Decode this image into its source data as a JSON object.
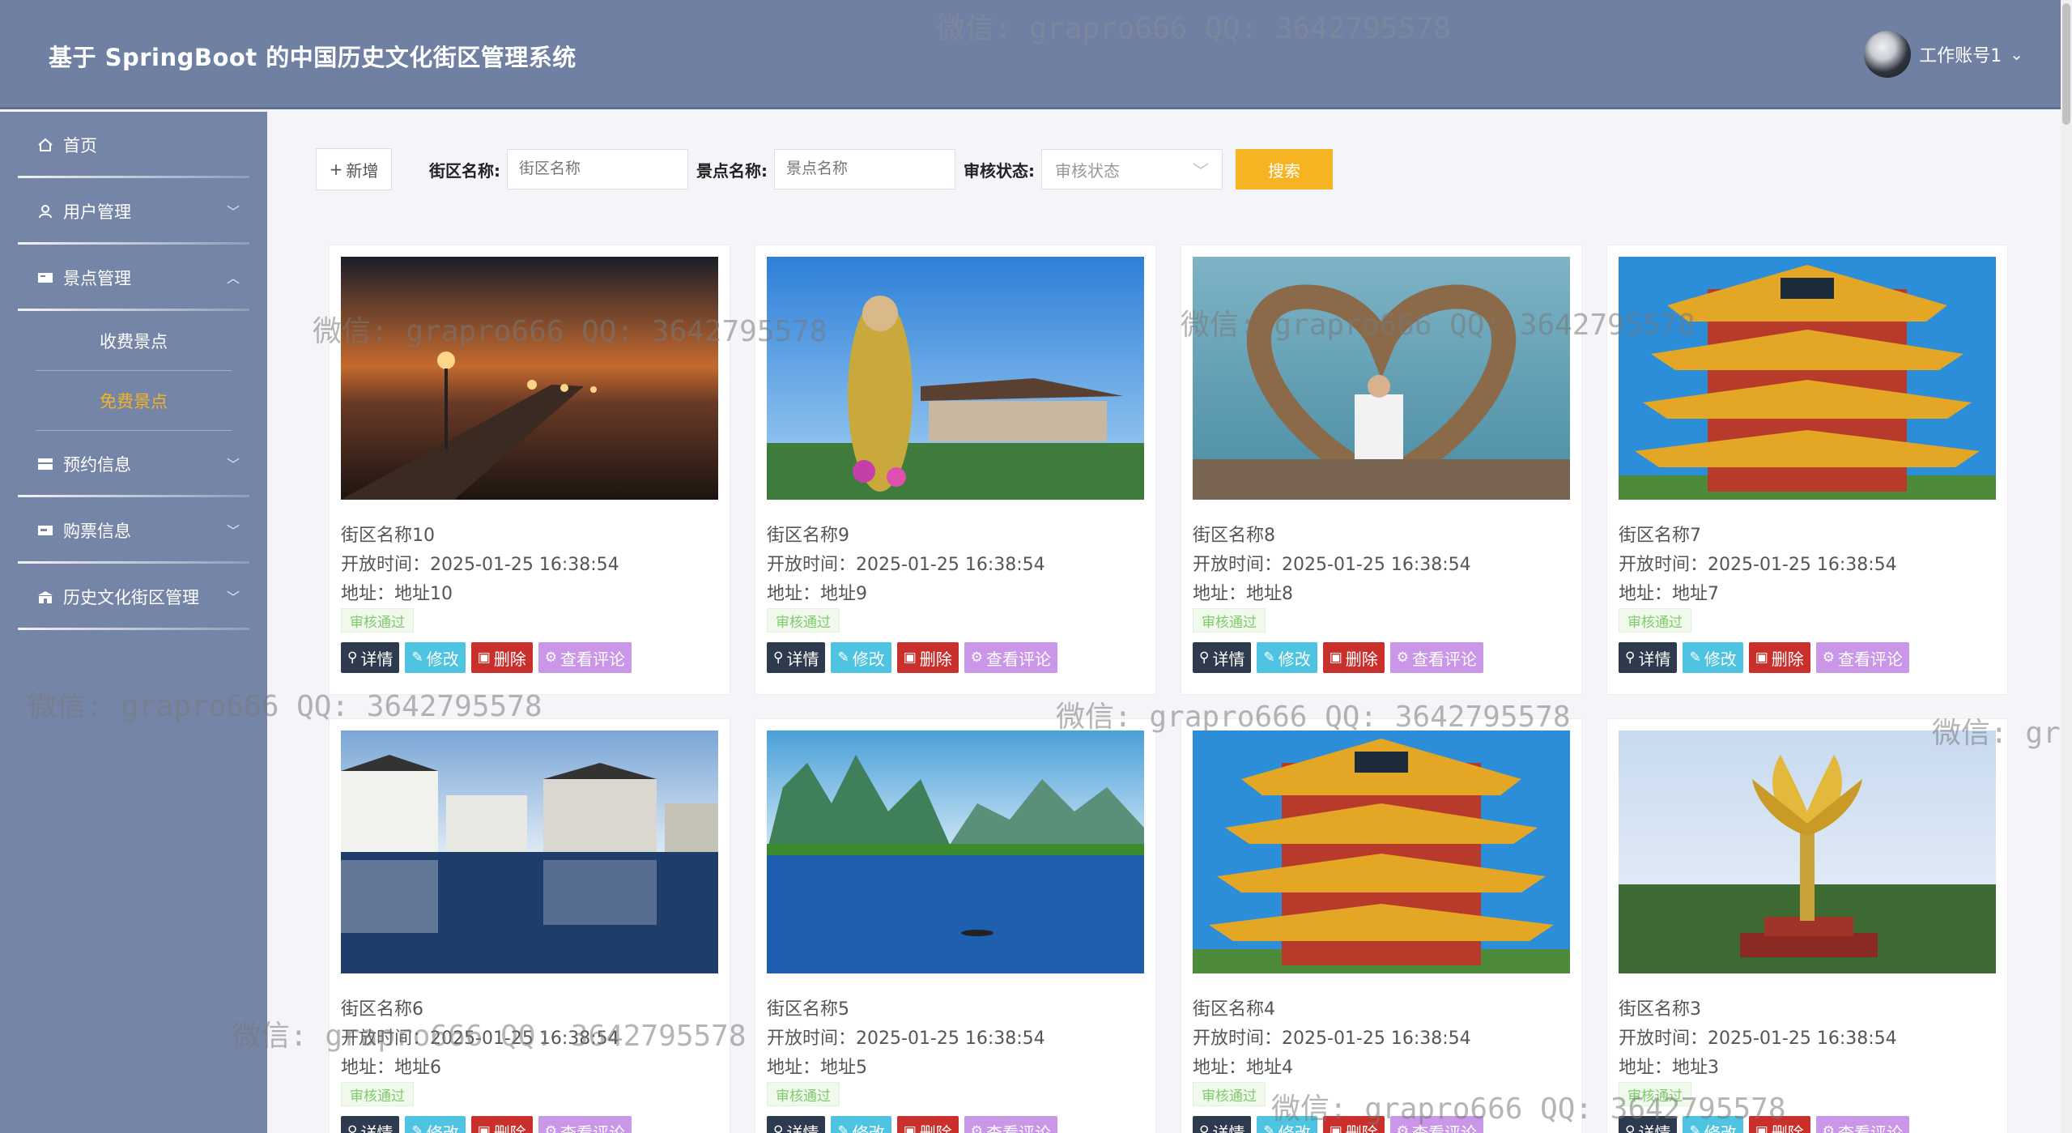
{
  "header": {
    "title": "基于 SpringBoot 的中国历史文化街区管理系统",
    "user": "工作账号1"
  },
  "sidebar": {
    "items": [
      {
        "label": "首页",
        "icon": "home-icon"
      },
      {
        "label": "用户管理",
        "icon": "user-icon"
      },
      {
        "label": "景点管理",
        "icon": "scenic-icon"
      },
      {
        "label": "预约信息",
        "icon": "booking-icon"
      },
      {
        "label": "购票信息",
        "icon": "ticket-icon"
      },
      {
        "label": "历史文化街区管理",
        "icon": "building-icon"
      }
    ],
    "sub_items": [
      {
        "label": "收费景点"
      },
      {
        "label": "免费景点"
      }
    ]
  },
  "toolbar": {
    "add_label": "新增",
    "district_label": "街区名称:",
    "district_placeholder": "街区名称",
    "spot_label": "景点名称:",
    "spot_placeholder": "景点名称",
    "status_label": "审核状态:",
    "status_placeholder": "审核状态",
    "search_label": "搜索"
  },
  "card_labels": {
    "time_prefix": "开放时间：",
    "addr_prefix": "地址：",
    "detail": "详情",
    "edit": "修改",
    "delete": "删除",
    "comment": "查看评论"
  },
  "cards": [
    {
      "name": "街区名称10",
      "time": "2025-01-25 16:38:54",
      "addr": "地址10",
      "status": "审核通过",
      "scene": "pier"
    },
    {
      "name": "街区名称9",
      "time": "2025-01-25 16:38:54",
      "addr": "地址9",
      "status": "审核通过",
      "scene": "statue"
    },
    {
      "name": "街区名称8",
      "time": "2025-01-25 16:38:54",
      "addr": "地址8",
      "status": "审核通过",
      "scene": "heart"
    },
    {
      "name": "街区名称7",
      "time": "2025-01-25 16:38:54",
      "addr": "地址7",
      "status": "审核通过",
      "scene": "tower"
    },
    {
      "name": "街区名称6",
      "time": "2025-01-25 16:38:54",
      "addr": "地址6",
      "status": "审核通过",
      "scene": "village"
    },
    {
      "name": "街区名称5",
      "time": "2025-01-25 16:38:54",
      "addr": "地址5",
      "status": "审核通过",
      "scene": "karst"
    },
    {
      "name": "街区名称4",
      "time": "2025-01-25 16:38:54",
      "addr": "地址4",
      "status": "审核通过",
      "scene": "tower"
    },
    {
      "name": "街区名称3",
      "time": "2025-01-25 16:38:54",
      "addr": "地址3",
      "status": "审核通过",
      "scene": "lotus"
    }
  ],
  "watermarks": [
    "微信: grapro666 QQ: 3642795578"
  ]
}
